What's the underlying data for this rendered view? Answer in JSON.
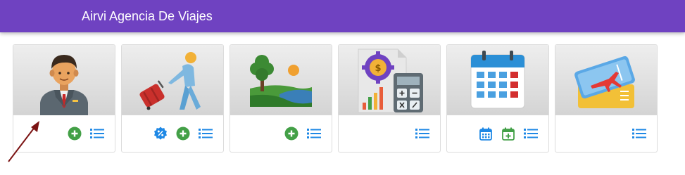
{
  "app": {
    "title": "Airvi Agencia De Viajes"
  },
  "colors": {
    "topbar": "#6f42c1",
    "add_green": "#43a047",
    "list_blue": "#1e88e5",
    "arrow": "#7b1313"
  },
  "cards": [
    {
      "image": "agent-illustration",
      "actions": [
        "add-icon",
        "list-icon"
      ]
    },
    {
      "image": "traveler-illustration",
      "actions": [
        "discount-icon",
        "add-icon",
        "list-icon"
      ]
    },
    {
      "image": "landscape-illustration",
      "actions": [
        "add-icon",
        "list-icon"
      ]
    },
    {
      "image": "finance-calculator-illustration",
      "actions": [
        "list-icon"
      ]
    },
    {
      "image": "calendar-illustration",
      "actions": [
        "calendar-view-icon",
        "calendar-add-icon",
        "list-icon"
      ]
    },
    {
      "image": "flight-tickets-illustration",
      "actions": [
        "list-icon"
      ]
    }
  ]
}
